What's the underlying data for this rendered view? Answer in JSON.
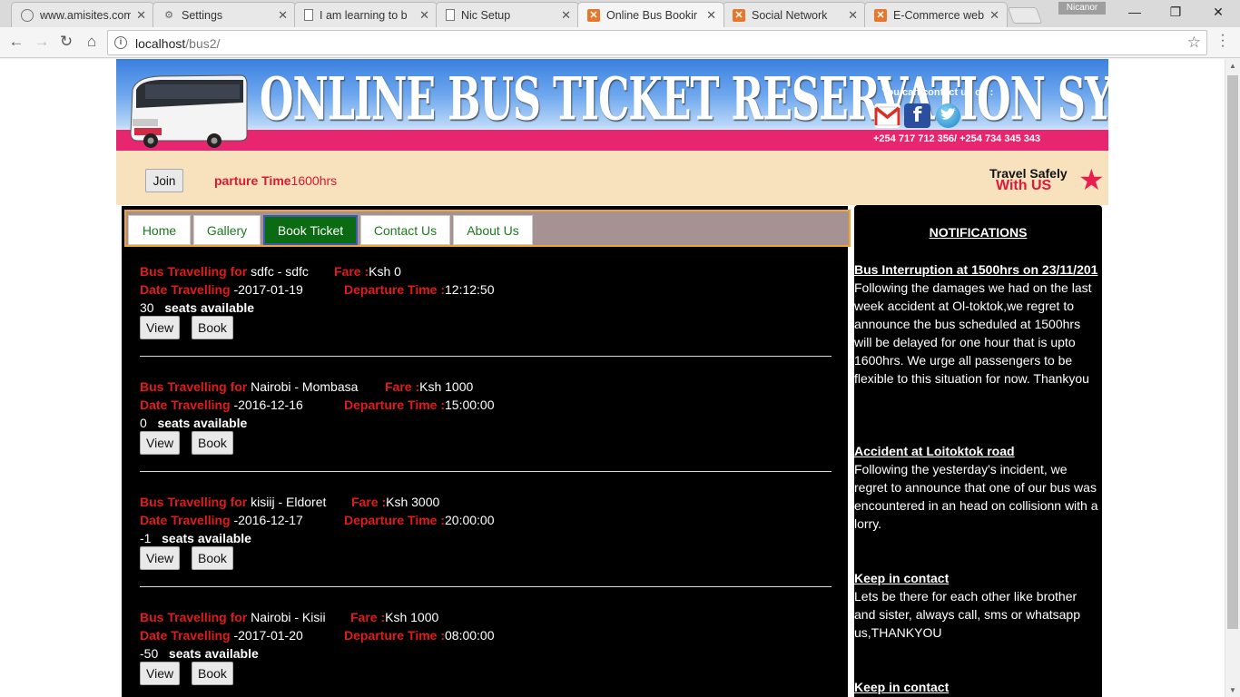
{
  "browser": {
    "tabs": [
      {
        "title": "www.amisites.com",
        "icon": "globe-icon"
      },
      {
        "title": "Settings",
        "icon": "gear-icon"
      },
      {
        "title": "I am learning to b",
        "icon": "page-icon"
      },
      {
        "title": "Nic Setup",
        "icon": "page-icon"
      },
      {
        "title": "Online Bus Bookir",
        "icon": "xampp-icon"
      },
      {
        "title": "Social Network",
        "icon": "xampp-icon"
      },
      {
        "title": "E-Commerce web",
        "icon": "xampp-icon"
      }
    ],
    "active_tab": 4,
    "profile_name": "Nicanor",
    "url_host": "localhost",
    "url_path": "/bus2/"
  },
  "banner": {
    "title": "ONLINE BUS TICKET RESERVATION SYSTEM",
    "contact_label": "You can contact us on :",
    "phones": "+254 717 712 356/ +254 734 345 343",
    "social_icons": [
      "gmail-icon",
      "facebook-icon",
      "twitter-icon"
    ]
  },
  "strip": {
    "join_label": "Join",
    "marquee_prefix": "parture Time",
    "marquee_value": "1600hrs",
    "travel_line1": "Travel Safely",
    "travel_line2": "With US"
  },
  "nav": {
    "items": [
      "Home",
      "Gallery",
      "Book Ticket",
      "Contact Us",
      "About Us"
    ],
    "active": "Book Ticket"
  },
  "labels": {
    "bus_travelling_for": "Bus Travelling for",
    "fare": "Fare :",
    "date_travelling": "Date Travelling",
    "departure_time": "Departure Time :",
    "seats_available": "seats available",
    "view": "View",
    "book": "Book"
  },
  "buses": [
    {
      "route": "sdfc - sdfc",
      "fare": "Ksh 0",
      "date": "-2017-01-19",
      "departure": "12:12:50",
      "seats": "30"
    },
    {
      "route": "Nairobi - Mombasa",
      "fare": "Ksh 1000",
      "date": "-2016-12-16",
      "departure": "15:00:00",
      "seats": "0"
    },
    {
      "route": "kisiij - Eldoret",
      "fare": "Ksh 3000",
      "date": "-2016-12-17",
      "departure": "20:00:00",
      "seats": "-1"
    },
    {
      "route": "Nairobi - Kisii",
      "fare": "Ksh 1000",
      "date": "-2017-01-20",
      "departure": "08:00:00",
      "seats": "-50"
    }
  ],
  "notifications": {
    "title": "NOTIFICATIONS",
    "items": [
      {
        "heading": "Bus Interruption at 1500hrs on 23/11/201",
        "body": "Following the damages we had on the last week accident at Ol-toktok,we regret to announce the bus scheduled at 1500hrs will be delayed for one hour that is upto 1600hrs. We urge all passengers to be flexible to this situation for now. Thankyou"
      },
      {
        "heading": "Accident at Loitoktok road",
        "body": "Following the yesterday's incident, we regret to announce that one of our bus was encountered in an head on collisionn with a lorry."
      },
      {
        "heading": "Keep in contact",
        "body": "Lets be there for each other like brother and sister, always call, sms or whatsapp us,THANKYOU"
      },
      {
        "heading": "Keep in contact",
        "body": ""
      }
    ]
  },
  "colors": {
    "accent_red": "#e01b1b",
    "active_nav": "#0a6b12",
    "banner_pink": "#e8266f",
    "strip_bg": "#f7e2bd"
  }
}
